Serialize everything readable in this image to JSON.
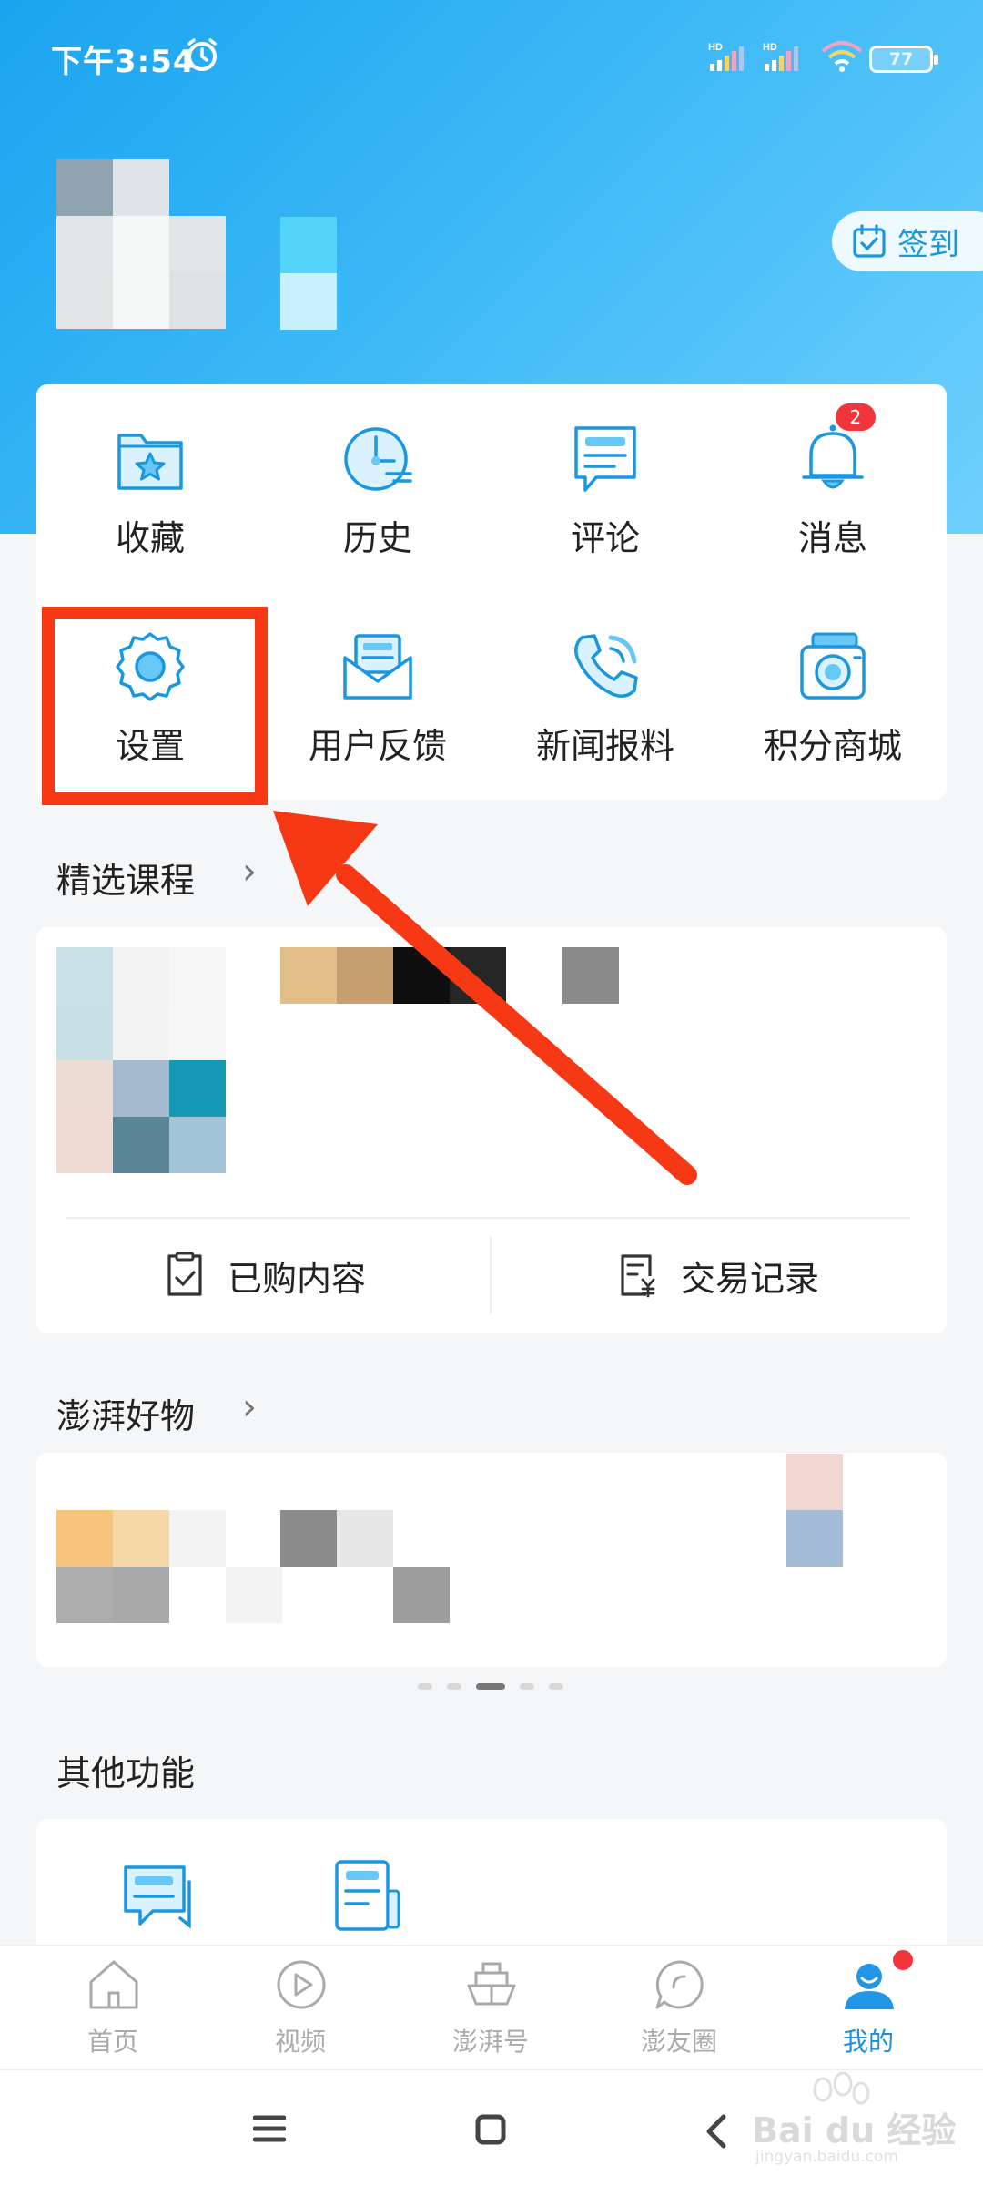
{
  "status_bar": {
    "time": "下午3:54",
    "signal_label": "HD",
    "battery": "77"
  },
  "header": {
    "checkin_label": "签到"
  },
  "grid": {
    "items": [
      {
        "label": "收藏",
        "icon": "favorites-icon"
      },
      {
        "label": "历史",
        "icon": "history-icon"
      },
      {
        "label": "评论",
        "icon": "comment-icon"
      },
      {
        "label": "消息",
        "icon": "bell-icon",
        "badge": "2"
      },
      {
        "label": "设置",
        "icon": "gear-icon"
      },
      {
        "label": "用户反馈",
        "icon": "feedback-icon"
      },
      {
        "label": "新闻报料",
        "icon": "phone-icon"
      },
      {
        "label": "积分商城",
        "icon": "camera-icon"
      }
    ]
  },
  "sections": {
    "courses_title": "精选课程",
    "purchased_label": "已购内容",
    "transactions_label": "交易记录",
    "goods_title": "澎湃好物",
    "other_title": "其他功能"
  },
  "carousel": {
    "count": 5,
    "active_index": 2
  },
  "tabbar": {
    "items": [
      {
        "label": "首页",
        "icon": "home-icon"
      },
      {
        "label": "视频",
        "icon": "video-icon"
      },
      {
        "label": "澎湃号",
        "icon": "ship-icon"
      },
      {
        "label": "澎友圈",
        "icon": "chat-circle-icon"
      },
      {
        "label": "我的",
        "icon": "user-icon",
        "active": true
      }
    ]
  },
  "watermark": {
    "text": "Bai du 经验",
    "sub": "jingyan.baidu.com"
  },
  "colors": {
    "accent": "#1a8fe0",
    "header_start": "#1aa4ef",
    "header_end": "#6fd0fd",
    "highlight": "#f73815",
    "badge": "#f0353b"
  }
}
